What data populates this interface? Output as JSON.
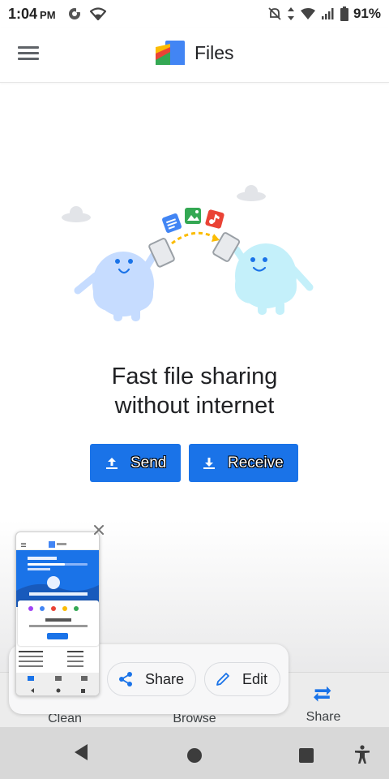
{
  "status_bar": {
    "time": "1:04",
    "ampm": "PM",
    "battery": "91%"
  },
  "app_bar": {
    "title": "Files"
  },
  "main": {
    "headline_line1": "Fast file sharing",
    "headline_line2": "without internet",
    "send_label": "Send",
    "receive_label": "Receive"
  },
  "bottom_nav": {
    "items": [
      {
        "label": "Clean",
        "icon": "clean-icon"
      },
      {
        "label": "Browse",
        "icon": "browse-icon"
      },
      {
        "label": "Share",
        "icon": "share-arrows-icon",
        "selected": true
      }
    ]
  },
  "screenshot_overlay": {
    "share_label": "Share",
    "edit_label": "Edit"
  },
  "colors": {
    "accent": "#1a73e8",
    "character_left": "#c6dcff",
    "character_right": "#c4f0fa"
  }
}
